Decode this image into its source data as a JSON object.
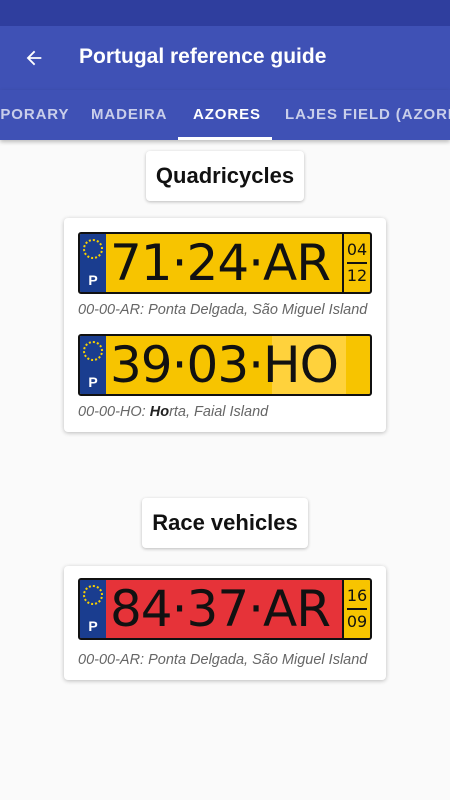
{
  "app_bar": {
    "title": "Portugal reference guide",
    "back_icon": "arrow-left-icon"
  },
  "tabs": [
    {
      "label": "TEMPORARY"
    },
    {
      "label": "MADEIRA"
    },
    {
      "label": "AZORES",
      "active": true
    },
    {
      "label": "LAJES FIELD (AZORES)"
    }
  ],
  "colors": {
    "status_bar": "#2f3e9e",
    "app_bar": "#3f51b5",
    "plate_yellow": "#f7c400",
    "plate_red": "#e63339",
    "eu_blue": "#1a3d8f"
  },
  "sections": [
    {
      "title": "Quadricycles",
      "plates": [
        {
          "text": "71·24·AR",
          "eu_letter": "P",
          "date_top": "04",
          "date_bottom": "12",
          "caption_prefix": "00-00-AR: Ponta Delgada, São Miguel Island",
          "caption_bold": "",
          "caption_rest": ""
        },
        {
          "text": "39·03·HO",
          "eu_letter": "P",
          "caption_prefix": "00-00-HO: ",
          "caption_bold": "Ho",
          "caption_rest": "rta, Faial Island"
        }
      ]
    },
    {
      "title": "Race vehicles",
      "plates": [
        {
          "text": "84·37·AR",
          "eu_letter": "P",
          "date_top": "16",
          "date_bottom": "09",
          "caption_prefix": "00-00-AR: Ponta Delgada, São Miguel Island",
          "caption_bold": "",
          "caption_rest": ""
        }
      ]
    }
  ]
}
